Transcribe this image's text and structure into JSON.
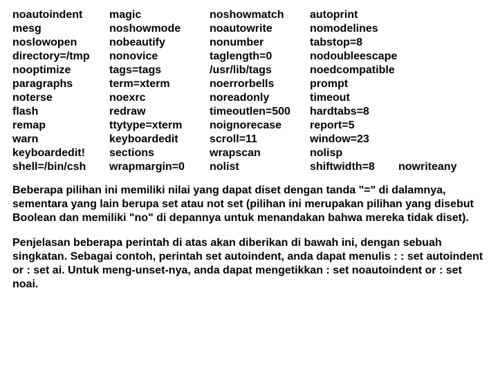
{
  "options": {
    "col1": [
      "noautoindent",
      "mesg",
      "noslowopen",
      "directory=/tmp",
      "nooptimize",
      "paragraphs",
      "noterse",
      "flash",
      "remap",
      "warn",
      "keyboardedit!",
      "shell=/bin/csh"
    ],
    "col2": [
      "magic",
      "noshowmode",
      "nobeautify",
      "nonovice",
      "tags=tags",
      "term=xterm",
      "noexrc",
      "redraw",
      "ttytype=xterm",
      "keyboardedit",
      "sections",
      "wrapmargin=0"
    ],
    "col3": [
      "noshowmatch",
      "noautowrite",
      "nonumber",
      "taglength=0",
      "/usr/lib/tags",
      "noerrorbells",
      "noreadonly",
      "timeoutlen=500",
      "noignorecase",
      "scroll=11",
      "wrapscan",
      "nolist"
    ],
    "col4": [
      "autoprint",
      "nomodelines",
      "tabstop=8",
      "nodoubleescape",
      "noedcompatible",
      "prompt",
      "timeout",
      "hardtabs=8",
      "report=5",
      "window=23",
      "nolisp",
      "shiftwidth=8"
    ],
    "col5_bottom": "nowriteany"
  },
  "paragraphs": {
    "p1": "Beberapa pilihan ini memiliki nilai yang dapat diset dengan tanda \"=\" di dalamnya, sementara yang lain berupa set atau not set (pilihan ini merupakan pilihan yang disebut Boolean dan memiliki \"no\" di depannya untuk menandakan bahwa mereka tidak diset).",
    "p2": "Penjelasan beberapa perintah di atas akan diberikan di bawah ini, dengan sebuah singkatan. Sebagai contoh, perintah set autoindent, anda dapat menulis : : set autoindent or : set ai. Untuk meng-unset-nya, anda dapat mengetikkan : set noautoindent or : set noai."
  }
}
